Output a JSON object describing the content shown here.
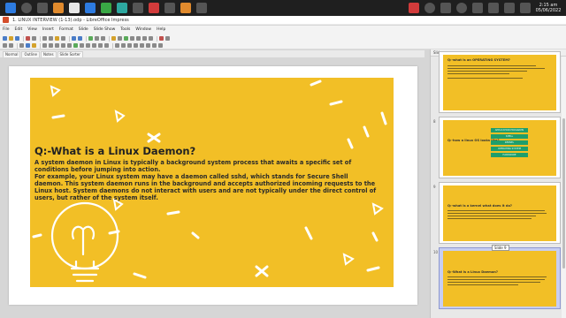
{
  "taskbar": {
    "clock_time": "2:15 am",
    "clock_date": "05/06/2022"
  },
  "window": {
    "title": "1. LINUX INTERVIEW (1-13).odp - LibreOffice Impress"
  },
  "menu": [
    "File",
    "Edit",
    "View",
    "Insert",
    "Format",
    "Slide",
    "Slide Show",
    "Tools",
    "Window",
    "Help"
  ],
  "view_tabs": [
    "Normal",
    "Outline",
    "Notes",
    "Slide Sorter"
  ],
  "slide": {
    "title": "Q:-What is a Linux Daemon?",
    "paragraphs": [
      "A system daemon in Linux is typically a background system process that awaits a specific set of conditions before jumping into action.",
      "For example, your Linux system may have a daemon called sshd, which stands for Secure Shell daemon. This system daemon runs in the background and accepts authorized incoming requests to the Linux host. System daemons do not interact with users and are not typically under the direct control of users, but rather of the system itself."
    ],
    "background_color": "#f2bf26",
    "decor_color": "#ffffff"
  },
  "slide_pane": {
    "header": "Slides",
    "thumbnails": [
      {
        "number": "",
        "title": "Q:-what is an OPERATING SYSTEM?"
      },
      {
        "number": "8",
        "title": "Q:-how a linux OS looks like?",
        "boxes": [
          "APPLICATION PROGRAMS",
          "SHELL",
          "KERNEL",
          "OPERATING SYSTEM",
          "HARDWARE"
        ]
      },
      {
        "number": "9",
        "title": "Q:-what is a kernel what does it do?"
      },
      {
        "number": "10",
        "title": "Q:-What is a Linux Daemon?",
        "active": true
      }
    ],
    "tooltip": "Slide 9"
  }
}
